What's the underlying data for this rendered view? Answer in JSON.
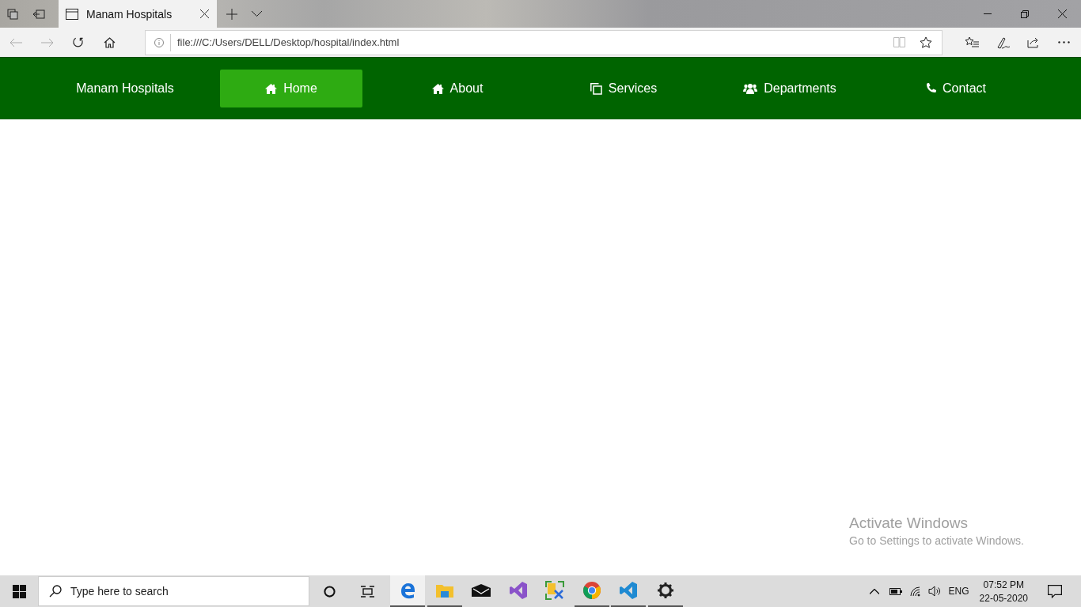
{
  "browser": {
    "tab_title": "Manam Hospitals",
    "address": "file:///C:/Users/DELL/Desktop/hospital/index.html"
  },
  "navbar": {
    "brand": "Manam Hospitals",
    "items": [
      {
        "label": "Home",
        "selected": true
      },
      {
        "label": "About",
        "selected": false
      },
      {
        "label": "Services",
        "selected": false
      },
      {
        "label": "Departments",
        "selected": false
      },
      {
        "label": "Contact",
        "selected": false
      }
    ]
  },
  "activation_notice": {
    "title": "Activate Windows",
    "message": "Go to Settings to activate Windows."
  },
  "taskbar": {
    "search_placeholder": "Type here to search",
    "apps": [
      {
        "running": true,
        "selected": true
      },
      {
        "running": true,
        "selected": false
      },
      {
        "running": false,
        "selected": false
      },
      {
        "running": false,
        "selected": false
      },
      {
        "running": false,
        "selected": false
      },
      {
        "running": true,
        "selected": false
      },
      {
        "running": true,
        "selected": false
      },
      {
        "running": true,
        "selected": false
      }
    ],
    "language": "ENG",
    "time": "07:52 PM",
    "date": "22-05-2020"
  }
}
